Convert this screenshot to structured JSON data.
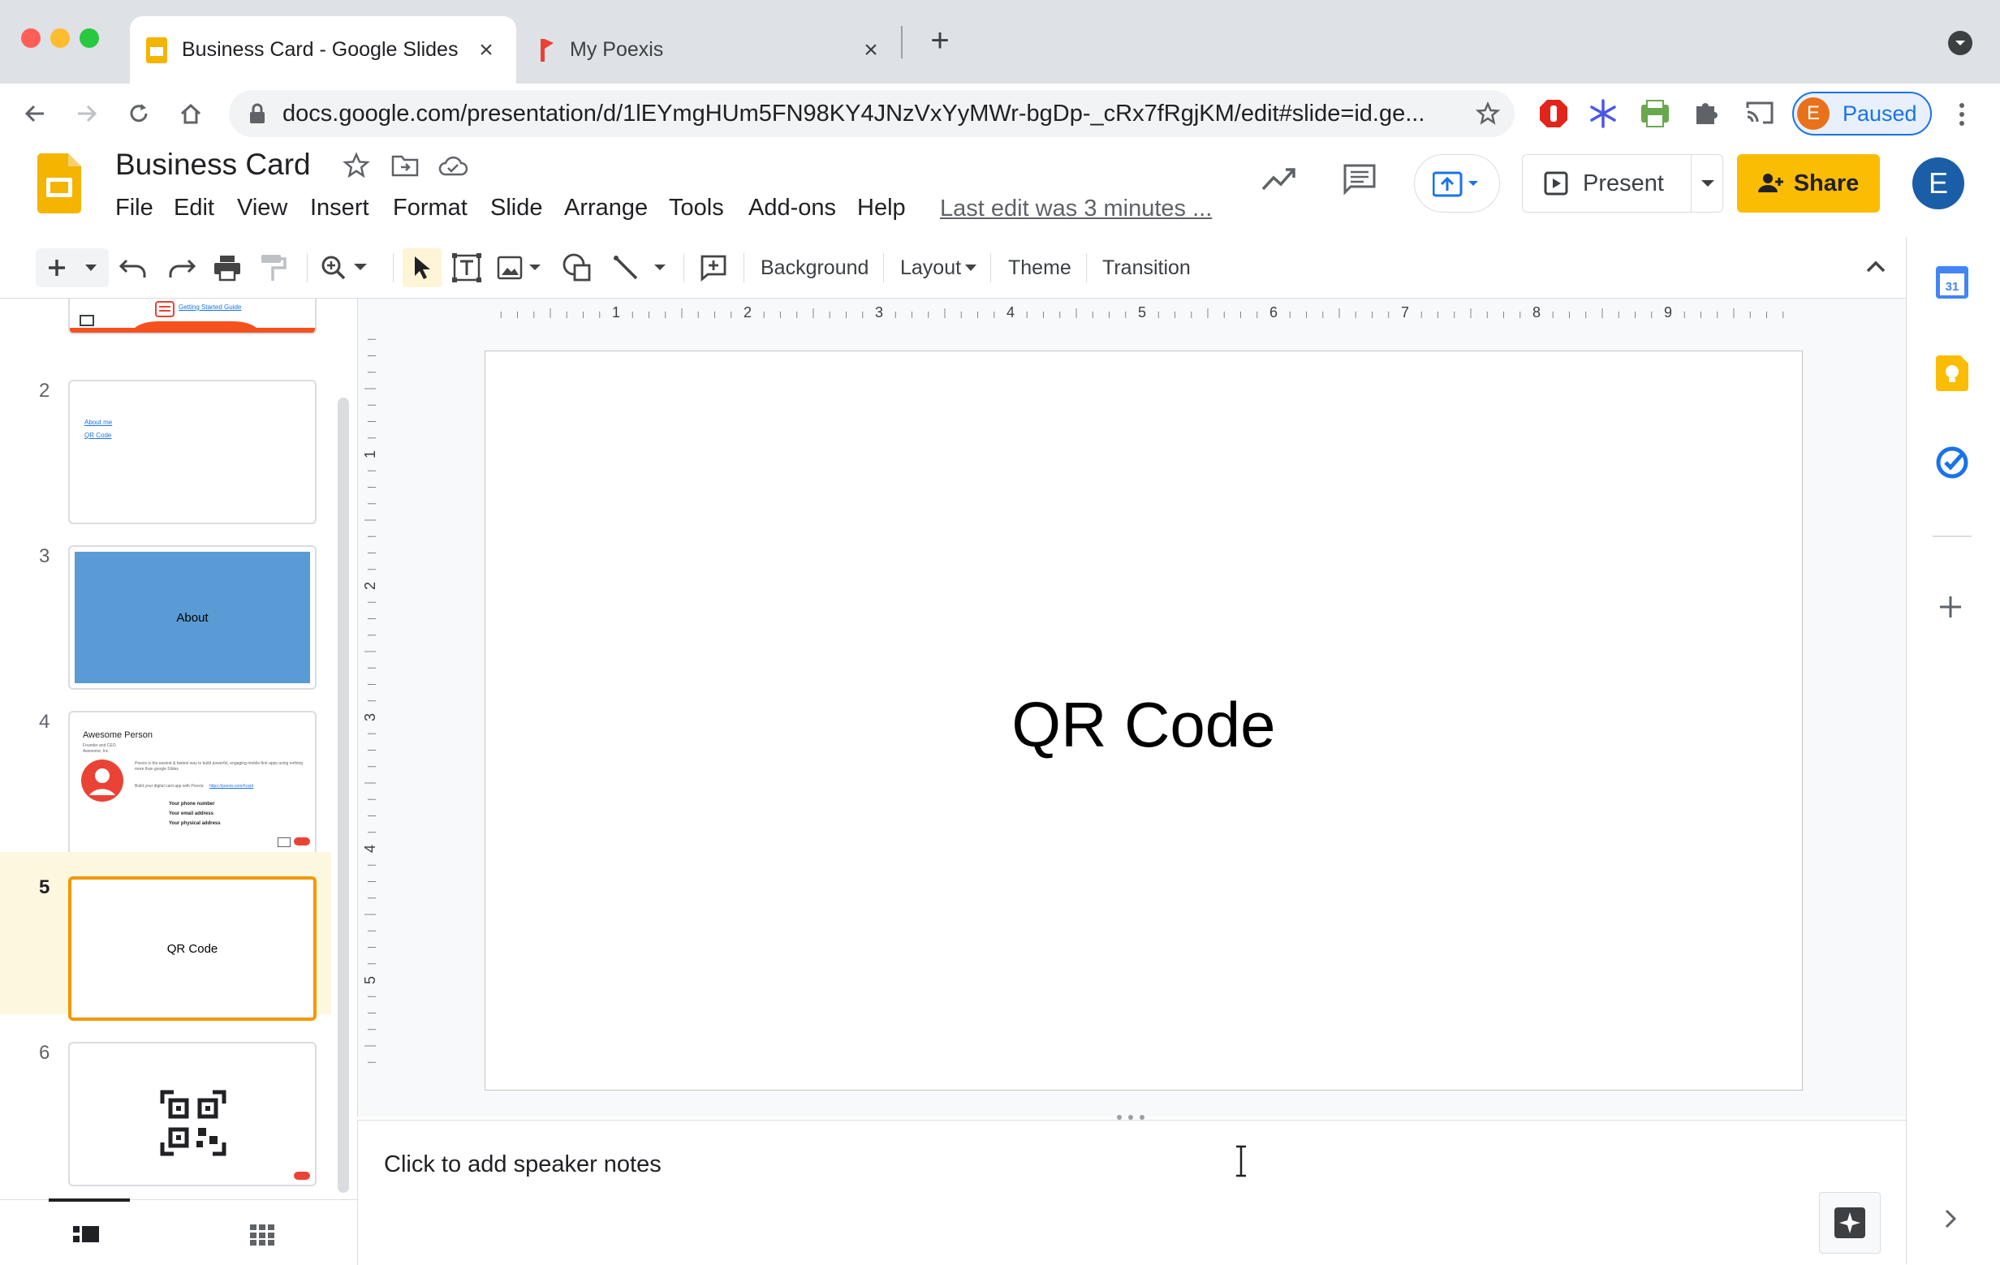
{
  "browser": {
    "tabs": [
      {
        "title": "Business Card - Google Slides",
        "active": true
      },
      {
        "title": "My Poexis",
        "active": false
      }
    ],
    "url": "docs.google.com/presentation/d/1lEYmgHUm5FN98KY4JNzVxYyMWr-bgDp-_cRx7fRgjKM/edit#slide=id.ge...",
    "profile_initial": "E",
    "profile_status": "Paused"
  },
  "app": {
    "doc_title": "Business Card",
    "menus": [
      "File",
      "Edit",
      "View",
      "Insert",
      "Format",
      "Slide",
      "Arrange",
      "Tools",
      "Add-ons",
      "Help"
    ],
    "last_edit": "Last edit was 3 minutes ...",
    "present_label": "Present",
    "share_label": "Share",
    "user_initial": "E"
  },
  "toolbar": {
    "background": "Background",
    "layout": "Layout",
    "theme": "Theme",
    "transition": "Transition"
  },
  "ruler": {
    "h_ticks": [
      "1",
      "2",
      "3",
      "4",
      "5",
      "6",
      "7",
      "8",
      "9"
    ],
    "v_ticks": [
      "1",
      "2",
      "3",
      "4",
      "5"
    ]
  },
  "slides": [
    {
      "number": "",
      "label": "Getting Started Guide"
    },
    {
      "number": "2",
      "links": [
        "About me",
        "QR Code"
      ]
    },
    {
      "number": "3",
      "label": "About"
    },
    {
      "number": "4",
      "name": "Awesome Person",
      "subtitle": "Founder and CEO",
      "company": "Awesome, Inc.",
      "blurb": "Poexis is the easiest & fastest way to build powerful, engaging mobile-first apps using nothing more than google Slides",
      "build_text": "Build your digital card app with Poexis:",
      "build_link": "https://poexis.com/#card",
      "fields": [
        "Your phone number",
        "Your email address",
        "Your physical address"
      ]
    },
    {
      "number": "5",
      "label": "QR Code",
      "selected": true
    },
    {
      "number": "6"
    }
  ],
  "canvas": {
    "slide_text": "QR Code"
  },
  "notes": {
    "placeholder": "Click to add speaker notes"
  },
  "colors": {
    "accent_yellow": "#fbbc04",
    "selected_border": "#f29900",
    "about_slide_bg": "#5b9bd5"
  }
}
